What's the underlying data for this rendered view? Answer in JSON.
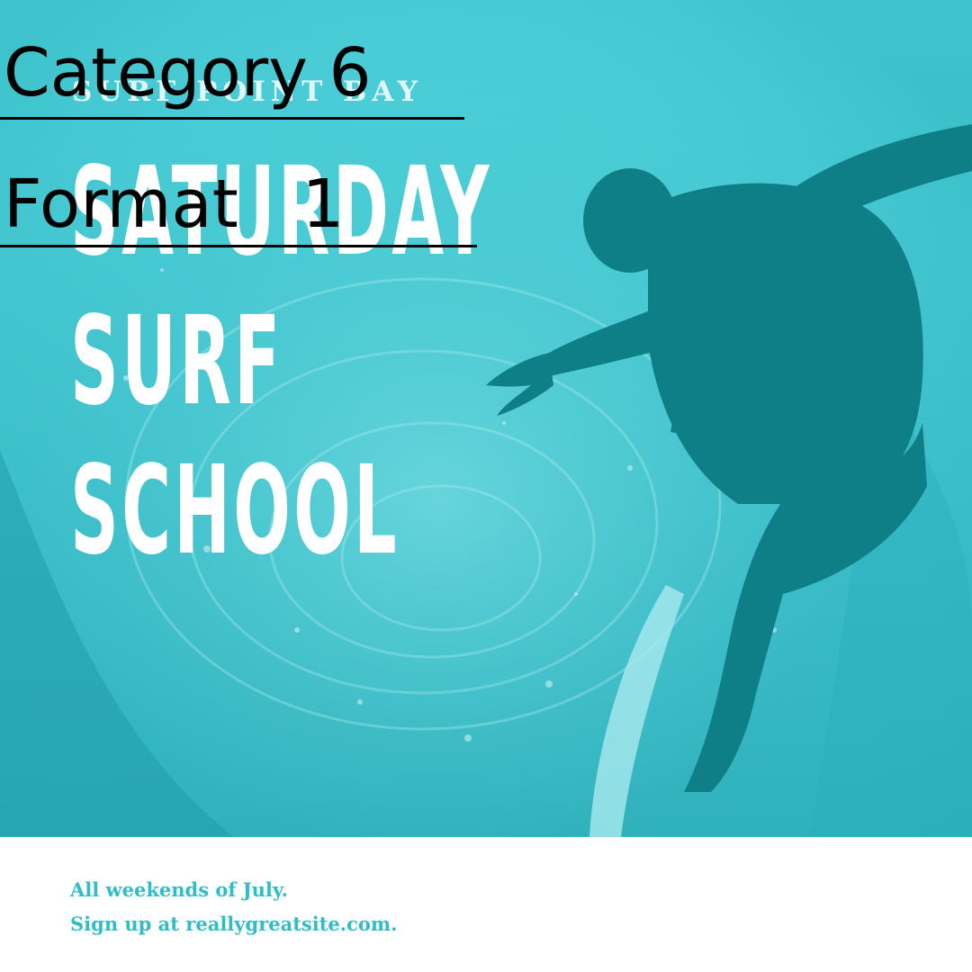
{
  "poster": {
    "brand": "SURF POINT BAY",
    "headline": [
      "SATURDAY",
      "SURF",
      "SCHOOL"
    ],
    "footer": [
      "All weekends of July.",
      "Sign up at reallygreatsite.com."
    ]
  },
  "overlay": {
    "category": "Category 6",
    "format": "Format   1"
  },
  "colors": {
    "photo_tint": "#44cdd6",
    "surfer_shadow": "#0f7f87",
    "footer_text": "#2fbdc8",
    "headline": "#ffffff"
  },
  "illustration": {
    "subject": "surfer-silhouette"
  }
}
